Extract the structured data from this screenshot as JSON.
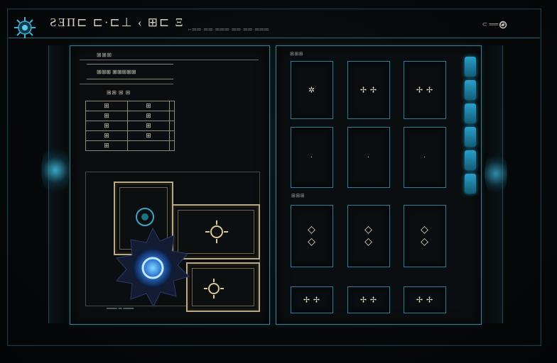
{
  "header": {
    "title": "ƧƎΠ⊏ ⊏·⊏⊥ ‹ ⊞⊏ Ξ",
    "subtitle": "⌐══ ══ ═══ ══ ══ ═══",
    "user_label": "⊂ ══ ⊘-"
  },
  "left_panel": {
    "section_label": "⊞⊞⊞",
    "field_value": "⊞⊞⊞ ⊞⊞⊞⊞⊞",
    "table_label": "⊞⊞ ⊞ ⊞",
    "table_rows": [
      [
        "⊞",
        "⊞",
        ""
      ],
      [
        "⊞",
        "⊞",
        ""
      ],
      [
        "⊞",
        "⊞",
        ""
      ],
      [
        "⊞",
        "⊞",
        ""
      ],
      [
        "⊞",
        "",
        ""
      ]
    ],
    "bottom_label": "═══ ═ ═══"
  },
  "right_panel": {
    "top_label": "⊞⊞⊞",
    "mid_label": "⊞⊞⊞",
    "rows": [
      [
        "✲",
        "✢ ✢",
        "✢ ✢"
      ],
      [
        "·",
        "·",
        "·"
      ],
      [
        "◇\n◇",
        "◇\n◇",
        "◇\n◇"
      ],
      [
        "✢ ✢",
        "✢ ✢",
        "✢ ✢"
      ]
    ]
  },
  "meter": {
    "levels": 6
  },
  "colors": {
    "accent": "#2e9cc4",
    "frame": "#3d7f90",
    "card_border": "#b9a984"
  }
}
